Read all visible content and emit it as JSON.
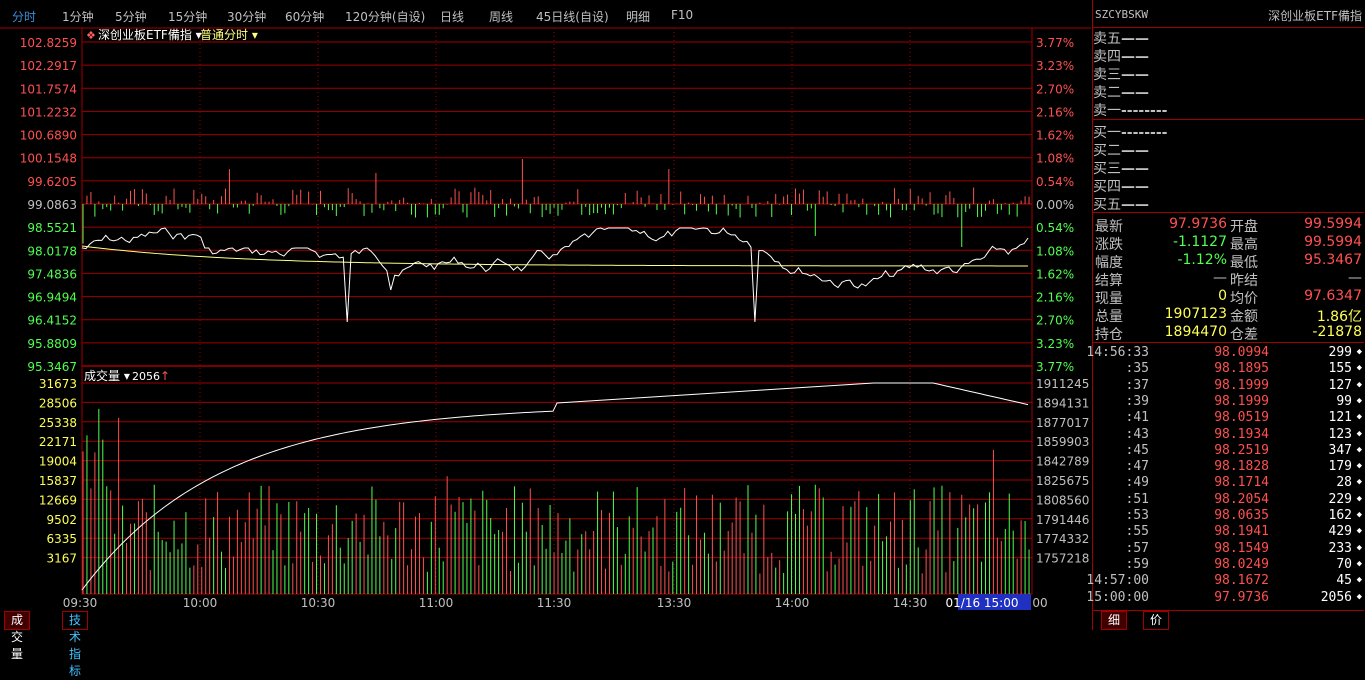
{
  "toolbar": {
    "tabs": [
      "分时",
      "1分钟",
      "5分钟",
      "15分钟",
      "30分钟",
      "60分钟",
      "120分钟(自设)",
      "日线",
      "周线",
      "45日线(自设)",
      "明细",
      "F10"
    ],
    "active": 0
  },
  "chart_title": {
    "name": "深创业板ETF備指",
    "mode": "普通分时"
  },
  "price_axis": {
    "left": [
      "102.8259",
      "102.2917",
      "101.7574",
      "101.2232",
      "100.6890",
      "100.1548",
      "99.6205",
      "99.0863",
      "98.5521",
      "98.0178",
      "97.4836",
      "96.9494",
      "96.4152",
      "95.8809",
      "95.3467"
    ],
    "right": [
      "3.77%",
      "3.23%",
      "2.70%",
      "2.16%",
      "1.62%",
      "1.08%",
      "0.54%",
      "0.00%",
      "0.54%",
      "1.08%",
      "1.62%",
      "2.16%",
      "2.70%",
      "3.23%",
      "3.77%"
    ]
  },
  "volume_header": {
    "label": "成交量",
    "value": "2056"
  },
  "volume_axis": {
    "left": [
      "31673",
      "28506",
      "25338",
      "22171",
      "19004",
      "15837",
      "12669",
      "9502",
      "6335",
      "3167"
    ],
    "right": [
      "1911245",
      "1894131",
      "1877017",
      "1859903",
      "1842789",
      "1825675",
      "1808560",
      "1791446",
      "1774332",
      "1757218"
    ]
  },
  "time_axis": [
    "09:30",
    "10:00",
    "10:30",
    "11:00",
    "11:30",
    "13:30",
    "14:00",
    "14:30",
    "01/16 15:00",
    "00"
  ],
  "bottom_tabs": [
    "成交量",
    "技术指标"
  ],
  "right_panel": {
    "code": "SZCYBSKW",
    "name": "深创业板ETF備指",
    "asks": [
      {
        "label": "卖五",
        "price": "—",
        "vol": "—"
      },
      {
        "label": "卖四",
        "price": "—",
        "vol": "—"
      },
      {
        "label": "卖三",
        "price": "—",
        "vol": "—"
      },
      {
        "label": "卖二",
        "price": "—",
        "vol": "—"
      },
      {
        "label": "卖一",
        "price": "----",
        "vol": "----"
      }
    ],
    "bids": [
      {
        "label": "买一",
        "price": "----",
        "vol": "----"
      },
      {
        "label": "买二",
        "price": "—",
        "vol": "—"
      },
      {
        "label": "买三",
        "price": "—",
        "vol": "—"
      },
      {
        "label": "买四",
        "price": "—",
        "vol": "—"
      },
      {
        "label": "买五",
        "price": "—",
        "vol": "—"
      }
    ],
    "stats": [
      {
        "l1": "最新",
        "v1": "97.9736",
        "l2": "开盘",
        "v2": "99.5994",
        "c1": "#ff5050",
        "c2": "#ff5050"
      },
      {
        "l1": "涨跌",
        "v1": "-1.1127",
        "l2": "最高",
        "v2": "99.5994",
        "c1": "#50ff50",
        "c2": "#ff5050"
      },
      {
        "l1": "幅度",
        "v1": "-1.12%",
        "l2": "最低",
        "v2": "95.3467",
        "c1": "#50ff50",
        "c2": "#ff5050"
      },
      {
        "l1": "结算",
        "v1": "—",
        "l2": "昨结",
        "v2": "—",
        "c1": "#c0c0c0",
        "c2": "#c0c0c0"
      },
      {
        "l1": "现量",
        "v1": "0",
        "l2": "均价",
        "v2": "97.6347",
        "c1": "#ffff55",
        "c2": "#ff5050"
      },
      {
        "l1": "总量",
        "v1": "1907123",
        "l2": "金额",
        "v2": "1.86亿",
        "c1": "#ffff55",
        "c2": "#ffff55"
      },
      {
        "l1": "持仓",
        "v1": "1894470",
        "l2": "仓差",
        "v2": "-21878",
        "c1": "#ffff55",
        "c2": "#ffff55"
      }
    ],
    "ticks": [
      {
        "t": "14:56:33",
        "p": "98.0994",
        "v": "299"
      },
      {
        "t": ":35",
        "p": "98.1895",
        "v": "155"
      },
      {
        "t": ":37",
        "p": "98.1999",
        "v": "127"
      },
      {
        "t": ":39",
        "p": "98.1999",
        "v": "99"
      },
      {
        "t": ":41",
        "p": "98.0519",
        "v": "121"
      },
      {
        "t": ":43",
        "p": "98.1934",
        "v": "123"
      },
      {
        "t": ":45",
        "p": "98.2519",
        "v": "347"
      },
      {
        "t": ":47",
        "p": "98.1828",
        "v": "179"
      },
      {
        "t": ":49",
        "p": "98.1714",
        "v": "28"
      },
      {
        "t": ":51",
        "p": "98.2054",
        "v": "229"
      },
      {
        "t": ":53",
        "p": "98.0635",
        "v": "162"
      },
      {
        "t": ":55",
        "p": "98.1941",
        "v": "429"
      },
      {
        "t": ":57",
        "p": "98.1549",
        "v": "233"
      },
      {
        "t": ":59",
        "p": "98.0249",
        "v": "70"
      },
      {
        "t": "14:57:00",
        "p": "98.1672",
        "v": "45"
      },
      {
        "t": "15:00:00",
        "p": "97.9736",
        "v": "2056"
      }
    ],
    "bottom_tabs": [
      "细",
      "价"
    ]
  },
  "colors": {
    "up": "#ff5050",
    "down": "#50ff50",
    "grid": "#a00000",
    "price_line": "#ffffff",
    "avg_line": "#ffff80",
    "accent": "#3a8fd8"
  }
}
